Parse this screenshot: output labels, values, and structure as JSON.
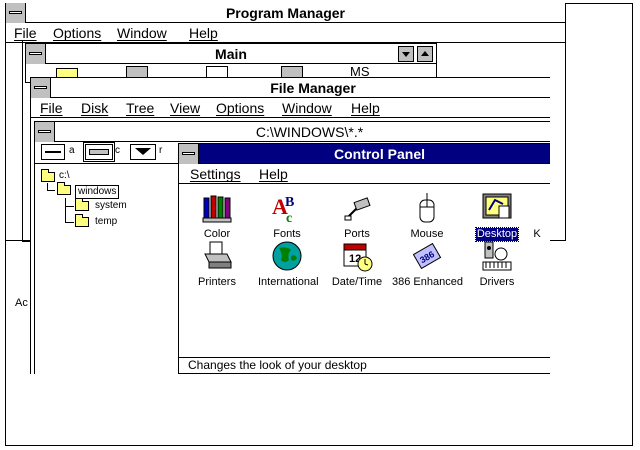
{
  "program_manager": {
    "title": "Program Manager",
    "menu": [
      "File",
      "Options",
      "Window",
      "Help"
    ],
    "main_group": {
      "title": "Main",
      "partial_icon_label": "MS"
    },
    "partial_label_left": "Ac"
  },
  "file_manager": {
    "title": "File Manager",
    "menu": [
      "File",
      "Disk",
      "Tree",
      "View",
      "Options",
      "Window",
      "Help"
    ],
    "dir_window": {
      "title": "C:\\WINDOWS\\*.*",
      "drives": [
        {
          "letter": "a",
          "type": "floppy"
        },
        {
          "letter": "c",
          "type": "hard-disk",
          "selected": true
        },
        {
          "letter": "r",
          "type": "cdrom"
        }
      ],
      "tree": [
        {
          "name": "c:\\",
          "level": 0
        },
        {
          "name": "windows",
          "level": 1,
          "selected": true,
          "open": true
        },
        {
          "name": "system",
          "level": 2
        },
        {
          "name": "temp",
          "level": 2
        }
      ]
    }
  },
  "control_panel": {
    "title": "Control Panel",
    "menu": [
      "Settings",
      "Help"
    ],
    "icons": [
      {
        "label": "Color",
        "icon": "color-icon"
      },
      {
        "label": "Fonts",
        "icon": "fonts-icon"
      },
      {
        "label": "Ports",
        "icon": "ports-icon"
      },
      {
        "label": "Mouse",
        "icon": "mouse-icon"
      },
      {
        "label": "Desktop",
        "icon": "desktop-icon",
        "selected": true
      },
      {
        "label": "K",
        "icon": "keyboard-icon"
      },
      {
        "label": "Printers",
        "icon": "printers-icon"
      },
      {
        "label": "International",
        "icon": "international-icon"
      },
      {
        "label": "Date/Time",
        "icon": "datetime-icon"
      },
      {
        "label": "386 Enhanced",
        "icon": "enhanced386-icon"
      },
      {
        "label": "Drivers",
        "icon": "drivers-icon"
      }
    ],
    "status": "Changes the look of your desktop"
  },
  "colors": {
    "active_title": "#000080",
    "inactive_title": "#ffffff",
    "selection": "#000080"
  }
}
